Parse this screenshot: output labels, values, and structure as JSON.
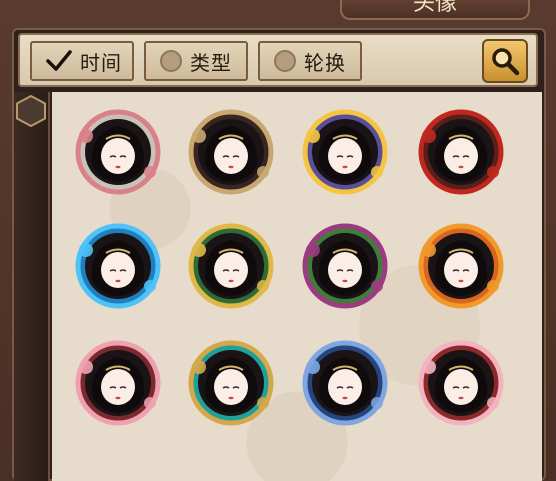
{
  "window": {
    "title": "头像"
  },
  "toolbar": {
    "filters": [
      {
        "label": "时间",
        "selected": true
      },
      {
        "label": "类型",
        "selected": false
      },
      {
        "label": "轮换",
        "selected": false
      }
    ],
    "search_icon": "search-icon"
  },
  "avatars": [
    {
      "frame": "lotus-frame",
      "ring": "#c9c2b6",
      "accent": "#d9808a"
    },
    {
      "frame": "plain-frame",
      "ring": "#3a2520",
      "accent": "#c8a870"
    },
    {
      "frame": "moon-frame",
      "ring": "#5c4f9a",
      "accent": "#f4c542"
    },
    {
      "frame": "torii-frame",
      "ring": "#5b1f1a",
      "accent": "#c0281f"
    },
    {
      "frame": "peacock-frame",
      "ring": "#1f7fbf",
      "accent": "#4fc3f7"
    },
    {
      "frame": "pine-frame",
      "ring": "#2f6b34",
      "accent": "#e0b84a"
    },
    {
      "frame": "snake-frame",
      "ring": "#3e7d3a",
      "accent": "#9c3b82"
    },
    {
      "frame": "maple-frame",
      "ring": "#d8661f",
      "accent": "#f19a2c"
    },
    {
      "frame": "plum-frame",
      "ring": "#7a2a2f",
      "accent": "#f0a1b0"
    },
    {
      "frame": "tassel-frame",
      "ring": "#1fa09a",
      "accent": "#d4a84a"
    },
    {
      "frame": "wave-frame",
      "ring": "#26457f",
      "accent": "#7fa6e0"
    },
    {
      "frame": "sakura-frame",
      "ring": "#8c2a2a",
      "accent": "#f3b3c0"
    }
  ]
}
